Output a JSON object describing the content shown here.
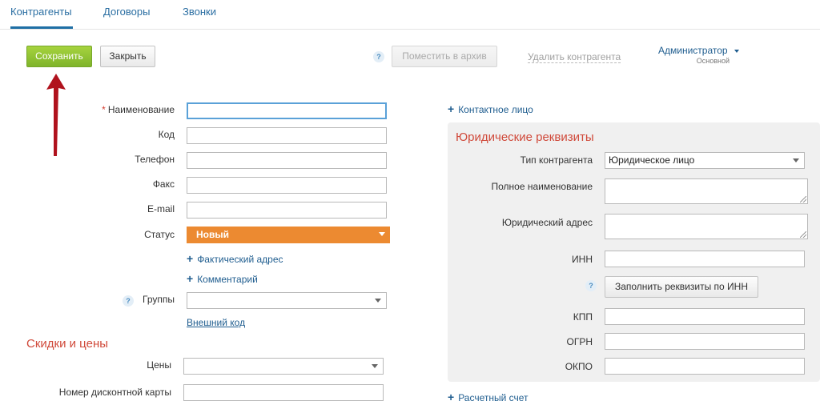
{
  "tabs": [
    {
      "label": "Контрагенты",
      "active": true
    },
    {
      "label": "Договоры",
      "active": false
    },
    {
      "label": "Звонки",
      "active": false
    }
  ],
  "toolbar": {
    "save_label": "Сохранить",
    "close_label": "Закрыть",
    "help_icon": "?",
    "archive_label": "Поместить в архив",
    "delete_label": "Удалить контрагента"
  },
  "user": {
    "name": "Администратор",
    "role": "Основной"
  },
  "form": {
    "name_label": "Наименование",
    "name_required": "*",
    "name_value": "",
    "code_label": "Код",
    "phone_label": "Телефон",
    "fax_label": "Факс",
    "email_label": "E-mail",
    "status_label": "Статус",
    "status_value": "Новый",
    "actual_address_link": "Фактический адрес",
    "comment_link": "Комментарий",
    "groups_help": "?",
    "groups_label": "Группы",
    "groups_value": "",
    "external_code_link": "Внешний код"
  },
  "discounts": {
    "title": "Скидки и цены",
    "prices_label": "Цены",
    "prices_value": "",
    "card_label": "Номер дисконтной карты"
  },
  "right": {
    "contact_link": "Контактное лицо",
    "legal_title": "Юридические реквизиты",
    "type_label": "Тип контрагента",
    "type_value": "Юридическое лицо",
    "full_name_label": "Полное наименование",
    "legal_address_label": "Юридический адрес",
    "inn_label": "ИНН",
    "inn_help": "?",
    "fill_by_inn_label": "Заполнить реквизиты по ИНН",
    "kpp_label": "КПП",
    "ogrn_label": "ОГРН",
    "okpo_label": "ОКПО",
    "account_link": "Расчетный счет"
  },
  "colors": {
    "accent": "#1f6fa5",
    "save_button": "#8cc036",
    "status": "#ec8a31",
    "section_title": "#d0493a",
    "arrow": "#b0121d"
  }
}
